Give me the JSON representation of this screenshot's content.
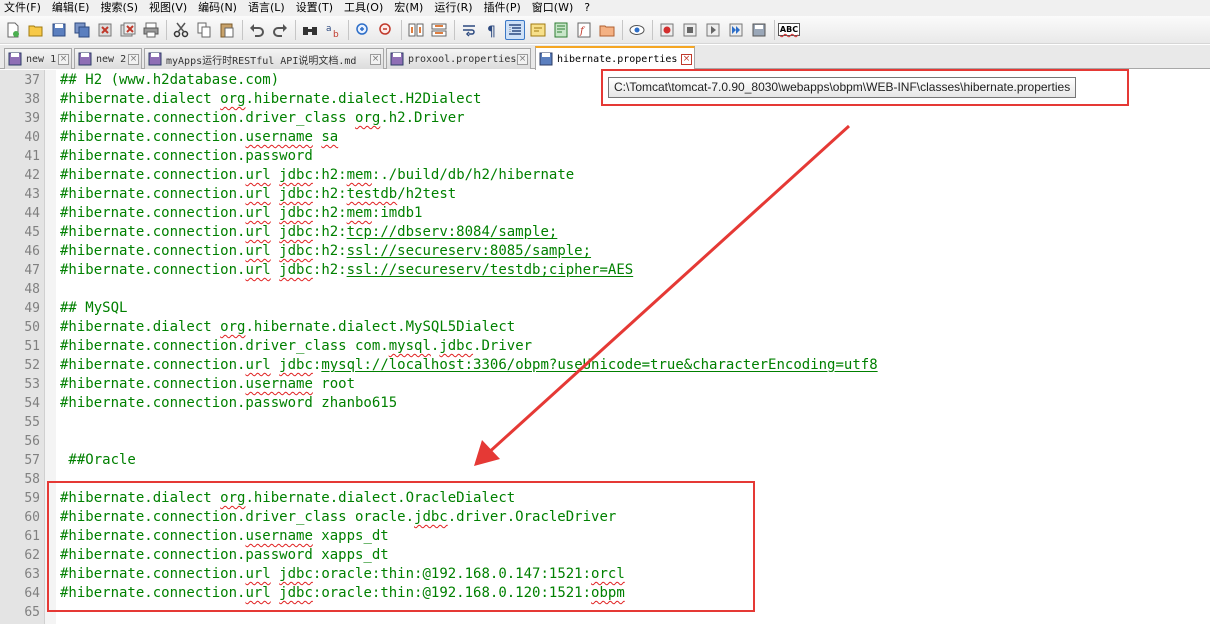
{
  "menu": [
    "文件(F)",
    "编辑(E)",
    "搜索(S)",
    "视图(V)",
    "编码(N)",
    "语言(L)",
    "设置(T)",
    "工具(O)",
    "宏(M)",
    "运行(R)",
    "插件(P)",
    "窗口(W)",
    "?"
  ],
  "toolbar": {
    "buttons": [
      "new-file-icon",
      "open-file-icon",
      "save-icon",
      "save-all-icon",
      "close-icon",
      "close-all-icon",
      "print-icon",
      "cut-icon",
      "copy-icon",
      "paste-icon",
      "undo-icon",
      "redo-icon",
      "find-icon",
      "replace-icon",
      "zoom-in-icon",
      "zoom-out-icon",
      "sync-vertical-icon",
      "sync-horizontal-icon",
      "word-wrap-icon",
      "show-all-characters-icon",
      "indent-guide-icon",
      "user-language-icon",
      "document-map-icon",
      "function-list-icon",
      "folder-as-workspace-icon",
      "monitoring-icon",
      "record-macro-icon",
      "stop-macro-icon",
      "play-macro-icon",
      "run-macro-multiple-icon",
      "save-macro-icon",
      "spell-check-icon"
    ],
    "spellcheck_label": "ABC"
  },
  "tabs": [
    {
      "label": "new 1",
      "active": false
    },
    {
      "label": "new 2",
      "active": false
    },
    {
      "label": "myApps运行时RESTful API说明文档.md",
      "active": false
    },
    {
      "label": "proxool.properties",
      "active": false
    },
    {
      "label": "hibernate.properties",
      "active": true
    }
  ],
  "tooltip": {
    "path": "C:\\Tomcat\\tomcat-7.0.90_8030\\webapps\\obpm\\WEB-INF\\classes\\hibernate.properties"
  },
  "editor": {
    "lines": [
      {
        "n": "37",
        "segs": [
          [
            "t",
            "## H2 (www.h2database.com)"
          ]
        ]
      },
      {
        "n": "38",
        "segs": [
          [
            "t",
            "#hibernate.dialect "
          ],
          [
            "s",
            "org"
          ],
          [
            "t",
            ".hibernate.dialect.H2Dialect"
          ]
        ]
      },
      {
        "n": "39",
        "segs": [
          [
            "t",
            "#hibernate.connection.driver_class "
          ],
          [
            "s",
            "org"
          ],
          [
            "t",
            ".h2.Driver"
          ]
        ]
      },
      {
        "n": "40",
        "segs": [
          [
            "t",
            "#hibernate.connection."
          ],
          [
            "s",
            "username"
          ],
          [
            "t",
            " "
          ],
          [
            "s",
            "sa"
          ]
        ]
      },
      {
        "n": "41",
        "segs": [
          [
            "t",
            "#hibernate.connection.password"
          ]
        ]
      },
      {
        "n": "42",
        "segs": [
          [
            "t",
            "#hibernate.connection."
          ],
          [
            "s",
            "url"
          ],
          [
            "t",
            " "
          ],
          [
            "s",
            "jdbc"
          ],
          [
            "t",
            ":h2:"
          ],
          [
            "s",
            "mem"
          ],
          [
            "t",
            ":./build/db/h2/hibernate"
          ]
        ]
      },
      {
        "n": "43",
        "segs": [
          [
            "t",
            "#hibernate.connection."
          ],
          [
            "s",
            "url"
          ],
          [
            "t",
            " "
          ],
          [
            "s",
            "jdbc"
          ],
          [
            "t",
            ":h2:"
          ],
          [
            "s",
            "testdb"
          ],
          [
            "t",
            "/h2test"
          ]
        ]
      },
      {
        "n": "44",
        "segs": [
          [
            "t",
            "#hibernate.connection."
          ],
          [
            "s",
            "url"
          ],
          [
            "t",
            " "
          ],
          [
            "s",
            "jdbc"
          ],
          [
            "t",
            ":h2:"
          ],
          [
            "s",
            "mem"
          ],
          [
            "t",
            ":imdb1"
          ]
        ]
      },
      {
        "n": "45",
        "segs": [
          [
            "t",
            "#hibernate.connection."
          ],
          [
            "s",
            "url"
          ],
          [
            "t",
            " "
          ],
          [
            "s",
            "jdbc"
          ],
          [
            "t",
            ":h2:"
          ],
          [
            "l",
            "tcp://dbserv:8084/sample;"
          ]
        ]
      },
      {
        "n": "46",
        "segs": [
          [
            "t",
            "#hibernate.connection."
          ],
          [
            "s",
            "url"
          ],
          [
            "t",
            " "
          ],
          [
            "s",
            "jdbc"
          ],
          [
            "t",
            ":h2:"
          ],
          [
            "l",
            "ssl://secureserv:8085/sample;"
          ]
        ]
      },
      {
        "n": "47",
        "segs": [
          [
            "t",
            "#hibernate.connection."
          ],
          [
            "s",
            "url"
          ],
          [
            "t",
            " "
          ],
          [
            "s",
            "jdbc"
          ],
          [
            "t",
            ":h2:"
          ],
          [
            "l",
            "ssl://secureserv/testdb;cipher=AES"
          ]
        ]
      },
      {
        "n": "48",
        "segs": []
      },
      {
        "n": "49",
        "segs": [
          [
            "t",
            "## MySQL"
          ]
        ]
      },
      {
        "n": "50",
        "segs": [
          [
            "t",
            "#hibernate.dialect "
          ],
          [
            "s",
            "org"
          ],
          [
            "t",
            ".hibernate.dialect.MySQL5Dialect"
          ]
        ]
      },
      {
        "n": "51",
        "segs": [
          [
            "t",
            "#hibernate.connection.driver_class com."
          ],
          [
            "s",
            "mysql"
          ],
          [
            "t",
            "."
          ],
          [
            "s",
            "jdbc"
          ],
          [
            "t",
            ".Driver"
          ]
        ]
      },
      {
        "n": "52",
        "segs": [
          [
            "t",
            "#hibernate.connection."
          ],
          [
            "s",
            "url"
          ],
          [
            "t",
            " "
          ],
          [
            "s",
            "jdbc"
          ],
          [
            "t",
            ":"
          ],
          [
            "l",
            "mysql://localhost:3306/obpm?useUnicode=true&characterEncoding=utf8"
          ]
        ]
      },
      {
        "n": "53",
        "segs": [
          [
            "t",
            "#hibernate.connection."
          ],
          [
            "s",
            "username"
          ],
          [
            "t",
            " root"
          ]
        ]
      },
      {
        "n": "54",
        "segs": [
          [
            "t",
            "#hibernate.connection.password zhanbo615"
          ]
        ]
      },
      {
        "n": "55",
        "segs": []
      },
      {
        "n": "56",
        "segs": []
      },
      {
        "n": "57",
        "segs": [
          [
            "t",
            " ##Oracle"
          ]
        ]
      },
      {
        "n": "58",
        "segs": []
      },
      {
        "n": "59",
        "segs": [
          [
            "t",
            "#hibernate.dialect "
          ],
          [
            "s",
            "org"
          ],
          [
            "t",
            ".hibernate.dialect.OracleDialect"
          ]
        ]
      },
      {
        "n": "60",
        "segs": [
          [
            "t",
            "#hibernate.connection.driver_class oracle."
          ],
          [
            "s",
            "jdbc"
          ],
          [
            "t",
            ".driver.OracleDriver"
          ]
        ]
      },
      {
        "n": "61",
        "segs": [
          [
            "t",
            "#hibernate.connection."
          ],
          [
            "s",
            "username"
          ],
          [
            "t",
            " xapps_dt"
          ]
        ]
      },
      {
        "n": "62",
        "segs": [
          [
            "t",
            "#hibernate.connection.password xapps_dt"
          ]
        ]
      },
      {
        "n": "63",
        "segs": [
          [
            "t",
            "#hibernate.connection."
          ],
          [
            "s",
            "url"
          ],
          [
            "t",
            " "
          ],
          [
            "s",
            "jdbc"
          ],
          [
            "t",
            ":oracle:thin:@192.168.0.147:1521:"
          ],
          [
            "s",
            "orcl"
          ]
        ]
      },
      {
        "n": "64",
        "segs": [
          [
            "t",
            "#hibernate.connection."
          ],
          [
            "s",
            "url"
          ],
          [
            "t",
            " "
          ],
          [
            "s",
            "jdbc"
          ],
          [
            "t",
            ":oracle:thin:@192.168.0.120:1521:"
          ],
          [
            "s",
            "obpm"
          ]
        ]
      },
      {
        "n": "65",
        "segs": []
      }
    ]
  },
  "colors": {
    "comment_text": "#008000",
    "line_number": "#808080",
    "annotation_red": "#e53935",
    "active_tab_accent": "#f5a623"
  }
}
